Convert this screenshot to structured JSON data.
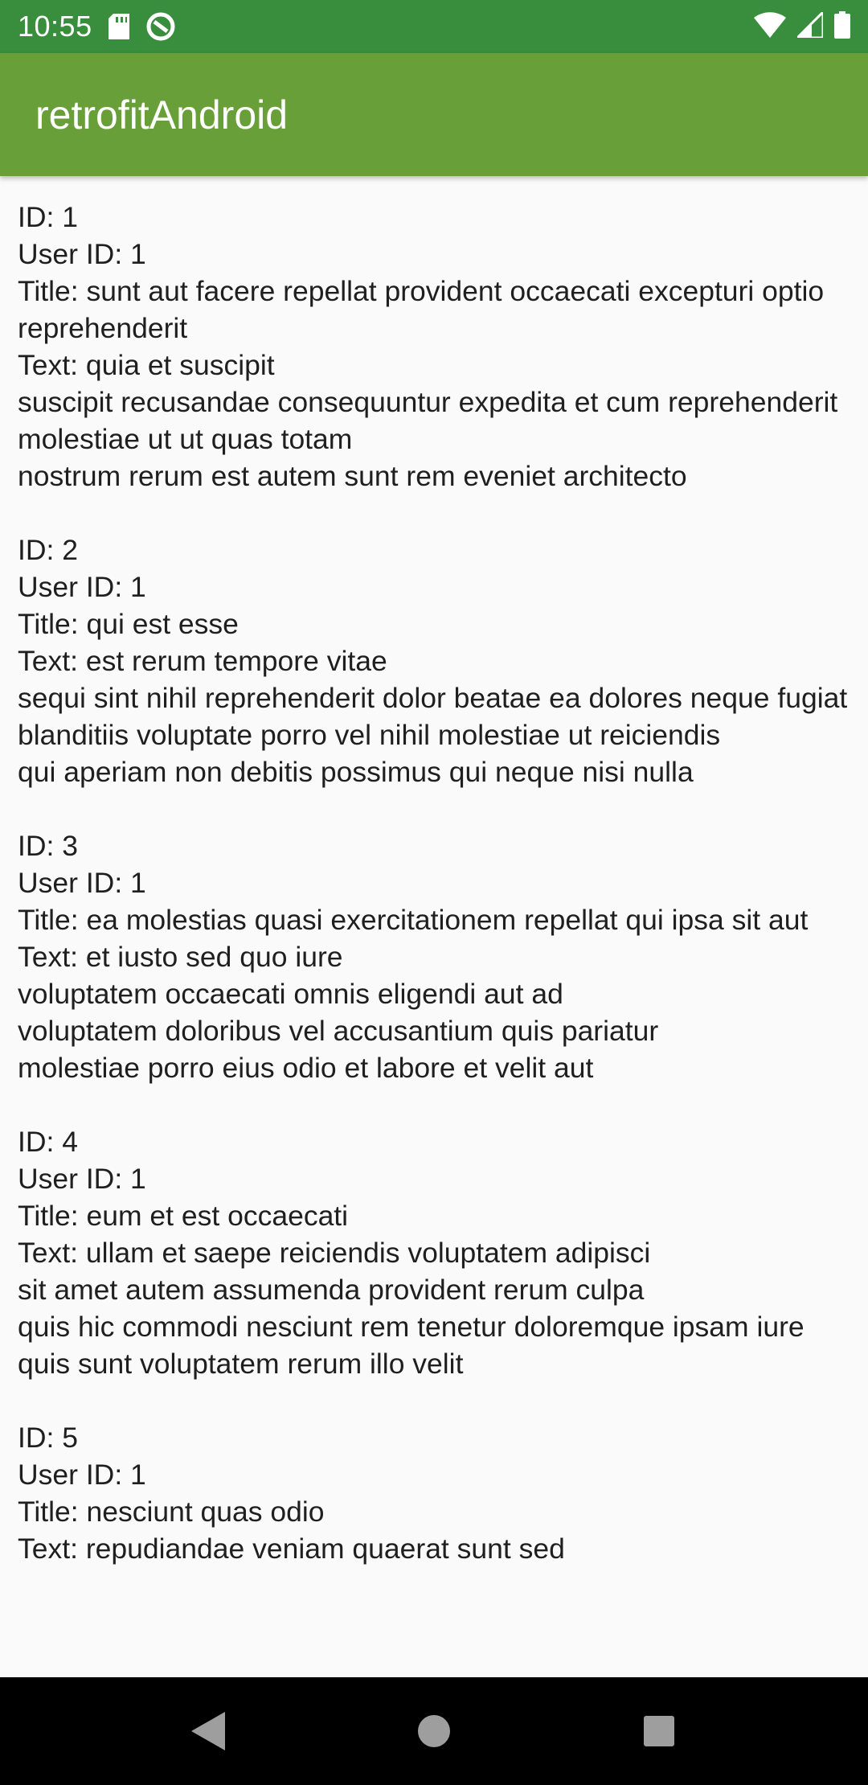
{
  "status_bar": {
    "time": "10:55",
    "icons_left": [
      "sd-card-icon",
      "data-saver-icon"
    ],
    "icons_right": [
      "wifi-icon",
      "signal-icon",
      "battery-icon"
    ]
  },
  "app_bar": {
    "title": "retrofitAndroid"
  },
  "posts": [
    {
      "id": "ID: 1",
      "user_id": "User ID: 1",
      "title": "Title: sunt aut facere repellat provident occaecati excepturi optio reprehenderit",
      "text_lines": [
        "Text: quia et suscipit",
        "suscipit recusandae consequuntur expedita et cum reprehenderit molestiae ut ut quas totam",
        "nostrum rerum est autem sunt rem eveniet architecto"
      ]
    },
    {
      "id": "ID: 2",
      "user_id": "User ID: 1",
      "title": "Title: qui est esse",
      "text_lines": [
        "Text: est rerum tempore vitae",
        "sequi sint nihil reprehenderit dolor beatae ea dolores neque fugiat blanditiis voluptate porro vel nihil molestiae ut reiciendis",
        "qui aperiam non debitis possimus qui neque nisi nulla"
      ]
    },
    {
      "id": "ID: 3",
      "user_id": "User ID: 1",
      "title": "Title: ea molestias quasi exercitationem repellat qui ipsa sit aut",
      "text_lines": [
        "Text: et iusto sed quo iure",
        "voluptatem occaecati omnis eligendi aut ad",
        "voluptatem doloribus vel accusantium quis pariatur",
        "molestiae porro eius odio et labore et velit aut"
      ]
    },
    {
      "id": "ID: 4",
      "user_id": "User ID: 1",
      "title": "Title: eum et est occaecati",
      "text_lines": [
        "Text: ullam et saepe reiciendis voluptatem adipisci",
        "sit amet autem assumenda provident rerum culpa",
        "quis hic commodi nesciunt rem tenetur doloremque ipsam iure",
        "quis sunt voluptatem rerum illo velit"
      ]
    },
    {
      "id": "ID: 5",
      "user_id": "User ID: 1",
      "title": "Title: nesciunt quas odio",
      "text_lines": [
        "Text: repudiandae veniam quaerat sunt sed"
      ]
    }
  ],
  "nav_bar": {
    "buttons": [
      "back-icon",
      "home-icon",
      "recents-icon"
    ]
  },
  "colors": {
    "status_bar": "#388e3c",
    "app_bar": "#689f38",
    "background": "#fafafa",
    "text": "#1f1f1f",
    "nav_bar": "#000000"
  }
}
